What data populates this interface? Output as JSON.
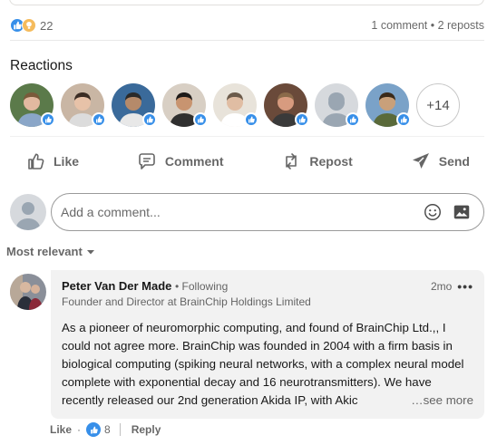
{
  "social_counts": {
    "reactions_count": "22",
    "comments_reposts": "1 comment • 2 reposts"
  },
  "reactions": {
    "heading": "Reactions",
    "avatars": [
      {
        "skin": "#e2b9a0",
        "hair": "#7a5a3a",
        "bg": "#5b7a4a",
        "shirt": "#8aa6c8"
      },
      {
        "skin": "#e7c2a8",
        "hair": "#3b2d24",
        "bg": "#c9b6a4",
        "shirt": "#dcdcdc"
      },
      {
        "skin": "#b58a6a",
        "hair": "#2a2a2a",
        "bg": "#3a6a9a",
        "shirt": "#e8e8e8"
      },
      {
        "skin": "#c89470",
        "hair": "#1e1a18",
        "bg": "#d8cfc4",
        "shirt": "#2f2f2f"
      },
      {
        "skin": "#e0bda3",
        "hair": "#6b5a4a",
        "bg": "#e8e3da",
        "shirt": "#ffffff"
      },
      {
        "skin": "#d79b7f",
        "hair": "#8a6a4a",
        "bg": "#6a4a3a",
        "shirt": "#3a3a3a"
      },
      {
        "skin": "#9aa6b2",
        "hair": "#9aa6b2",
        "bg": "#d6d9dd",
        "shirt": "#9aa6b2"
      },
      {
        "skin": "#c9a07a",
        "hair": "#3a2a1a",
        "bg": "#7aa2c8",
        "shirt": "#5a6a3a"
      }
    ],
    "more_label": "+14"
  },
  "actions": {
    "like": "Like",
    "comment": "Comment",
    "repost": "Repost",
    "send": "Send"
  },
  "comment_box": {
    "placeholder": "Add a comment..."
  },
  "sort": {
    "label": "Most relevant"
  },
  "comment": {
    "author": "Peter Van Der Made",
    "relationship": "• Following",
    "headline": "Founder and Director at BrainChip Holdings Limited",
    "time": "2mo",
    "text": "As a pioneer of neuromorphic computing, and found of BrainChip Ltd.,, I could not agree more. BrainChip was founded in 2004 with a firm basis in biological computing (spiking neural networks, with a complex neural model complete with exponential decay and 16 neurotransmitters). We have recently released our 2nd generation Akida IP, with Akic",
    "see_more": "…see more",
    "like_label": "Like",
    "separator": "·",
    "like_count": "8",
    "reply_label": "Reply"
  },
  "colors": {
    "like_blue": "#378fe9",
    "insight_yellow": "#f5bb5c",
    "bubble_bg": "#f2f2f2"
  }
}
